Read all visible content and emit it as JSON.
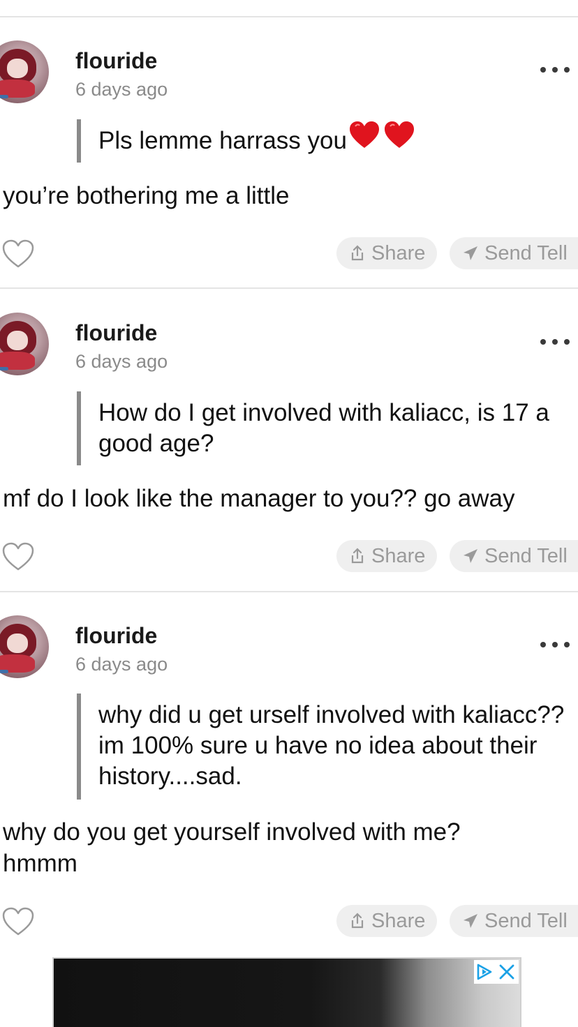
{
  "posts": [
    {
      "username": "flouride",
      "time": "6 days ago",
      "question": "Pls lemme harrass you",
      "question_emoji": "❤❤",
      "answer": "you’re bothering me a little",
      "share_label": "Share",
      "tell_label": "Send Tell"
    },
    {
      "username": "flouride",
      "time": "6 days ago",
      "question": "How do I get involved with kaliacc, is 17 a good age?",
      "answer": "mf do I look like the manager to you?? go away",
      "share_label": "Share",
      "tell_label": "Send Tell"
    },
    {
      "username": "flouride",
      "time": "6 days ago",
      "question": "why did u get urself involved with kaliacc?? im 100% sure u have no idea about their history....sad.",
      "answer": "why do you get yourself involved with me? hmmm",
      "share_label": "Share",
      "tell_label": "Send Tell"
    }
  ],
  "icons": {
    "like": "heart-outline-icon",
    "share": "share-icon",
    "send_tell": "paper-plane-icon",
    "more": "more-dots-icon",
    "ad_choices": "adchoices-icon",
    "ad_close": "close-icon"
  },
  "colors": {
    "text": "#111111",
    "secondary_text": "#8a8a8a",
    "quote_bar": "#8a8a8a",
    "pill_bg": "#efefef",
    "pill_text": "#9a9a9a",
    "heart_emoji": "#e0141e",
    "ad_icon": "#1aa1e6"
  }
}
